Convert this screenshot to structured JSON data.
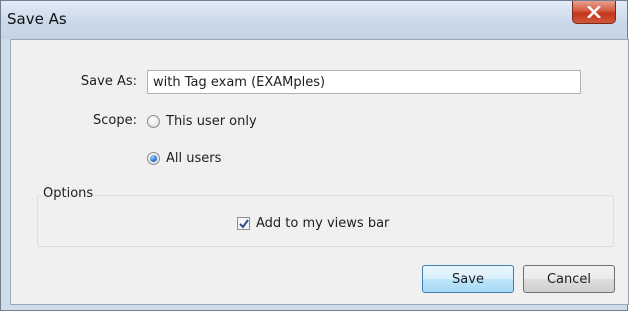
{
  "window": {
    "title": "Save As",
    "close_icon": "close-icon"
  },
  "form": {
    "name_label": "Save As:",
    "name_value": "with Tag exam (EXAMples)",
    "scope_label": "Scope:",
    "scope_options": [
      {
        "label": "This user only",
        "selected": false
      },
      {
        "label": "All users",
        "selected": true
      }
    ]
  },
  "options": {
    "legend": "Options",
    "add_to_views_bar": {
      "label": "Add to my views bar",
      "checked": true
    }
  },
  "buttons": {
    "save": "Save",
    "cancel": "Cancel"
  },
  "colors": {
    "close_button": "#c2371d",
    "default_button_border": "#3c7fb1",
    "radio_selected": "#2f7fd6"
  }
}
